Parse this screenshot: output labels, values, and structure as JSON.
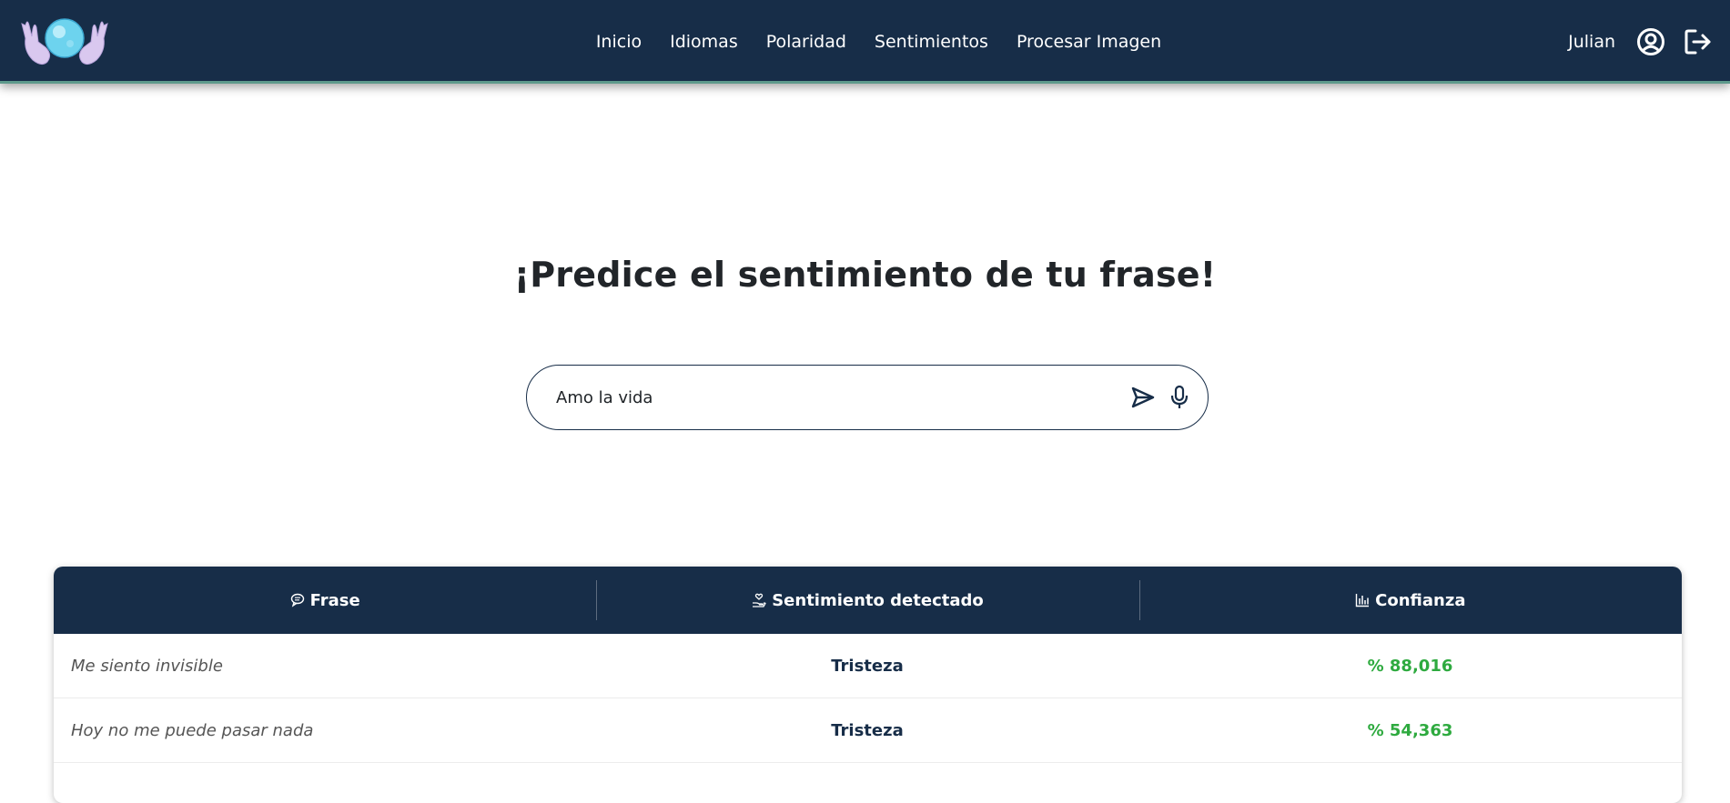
{
  "navbar": {
    "links": [
      "Inicio",
      "Idiomas",
      "Polaridad",
      "Sentimientos",
      "Procesar Imagen"
    ],
    "user_name": "Julian"
  },
  "main": {
    "title": "¡Predice el sentimiento de tu frase!",
    "search": {
      "value": "Amo la vida"
    }
  },
  "table": {
    "headers": [
      "Frase",
      "Sentimiento detectado",
      "Confianza"
    ],
    "rows": [
      {
        "phrase": "Me siento invisible",
        "sentiment": "Tristeza",
        "confidence": "% 88,016"
      },
      {
        "phrase": "Hoy no me puede pasar nada",
        "sentiment": "Tristeza",
        "confidence": "% 54,363"
      }
    ]
  },
  "icons": {
    "logo": "crystal-ball-hands-logo",
    "profile": "user-circle-icon",
    "logout": "logout-icon",
    "send": "send-icon",
    "mic": "microphone-icon",
    "header_phrase": "chat-bubble-icon",
    "header_sentiment": "hand-heart-icon",
    "header_confidence": "bar-chart-icon"
  },
  "colors": {
    "navbar": "#172d48",
    "accent_line": "#5e9a8c",
    "confidence_text": "#2eaa3f"
  }
}
